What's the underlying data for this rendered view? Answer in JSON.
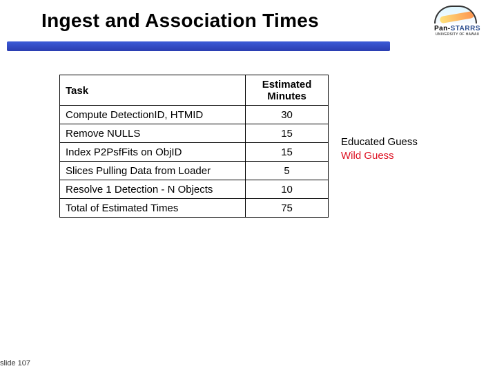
{
  "title": "Ingest and Association Times",
  "logo": {
    "brand_prefix": "Pan-",
    "brand_main": "STARRS",
    "subtitle": "UNIVERSITY OF HAWAII"
  },
  "table": {
    "headers": {
      "task": "Task",
      "minutes": "Estimated Minutes"
    },
    "rows": [
      {
        "task": "Compute DetectionID, HTMID",
        "minutes": "30"
      },
      {
        "task": "Remove NULLS",
        "minutes": "15"
      },
      {
        "task": "Index P2PsfFits on ObjID",
        "minutes": "15"
      },
      {
        "task": "Slices Pulling Data from Loader",
        "minutes": "5"
      },
      {
        "task": "Resolve 1 Detection - N Objects",
        "minutes": "10"
      },
      {
        "task": "Total of Estimated Times",
        "minutes": "75"
      }
    ]
  },
  "legend": {
    "educated": "Educated Guess",
    "wild": "Wild Guess"
  },
  "slide_number": "slide 107"
}
